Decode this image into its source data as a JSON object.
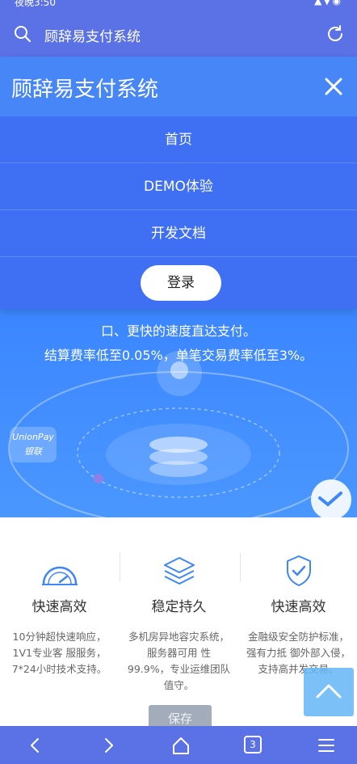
{
  "status_bar": {
    "time": "夜晚3:50",
    "system_icons": "▲▼◉"
  },
  "address_bar": {
    "url_text": "顾辞易支付系统"
  },
  "menu": {
    "title": "顾辞易支付系统",
    "items": [
      {
        "label": "首页"
      },
      {
        "label": "DEMO体验"
      },
      {
        "label": "开发文档"
      }
    ],
    "login_label": "登录"
  },
  "hero": {
    "line1": "口、更快的速度直达支付。",
    "line2": "结算费率低至0.05%，单笔交易费率低至3%。",
    "unionpay_label": "UnionPay",
    "unionpay_cn": "银联"
  },
  "features": [
    {
      "icon": "speedometer-icon",
      "title": "快速高效",
      "desc": "10分钟超快速响应，1V1专业客 服服务，7*24小时技术支持。"
    },
    {
      "icon": "layers-icon",
      "title": "稳定持久",
      "desc": "多机房异地容灾系统，服务器可用 性99.9%，专业运维团队值守。"
    },
    {
      "icon": "shield-check-icon",
      "title": "快速高效",
      "desc": "金融级安全防护标准，强有力抵 御外部入侵，支持高并发交易。"
    }
  ],
  "save_label": "保存",
  "bottom_nav": {
    "tab_count": "3"
  },
  "colors": {
    "brand": "#5b71e6",
    "menu": "#3f6ff3",
    "accent": "#4786f6",
    "icon": "#3f86f6"
  }
}
